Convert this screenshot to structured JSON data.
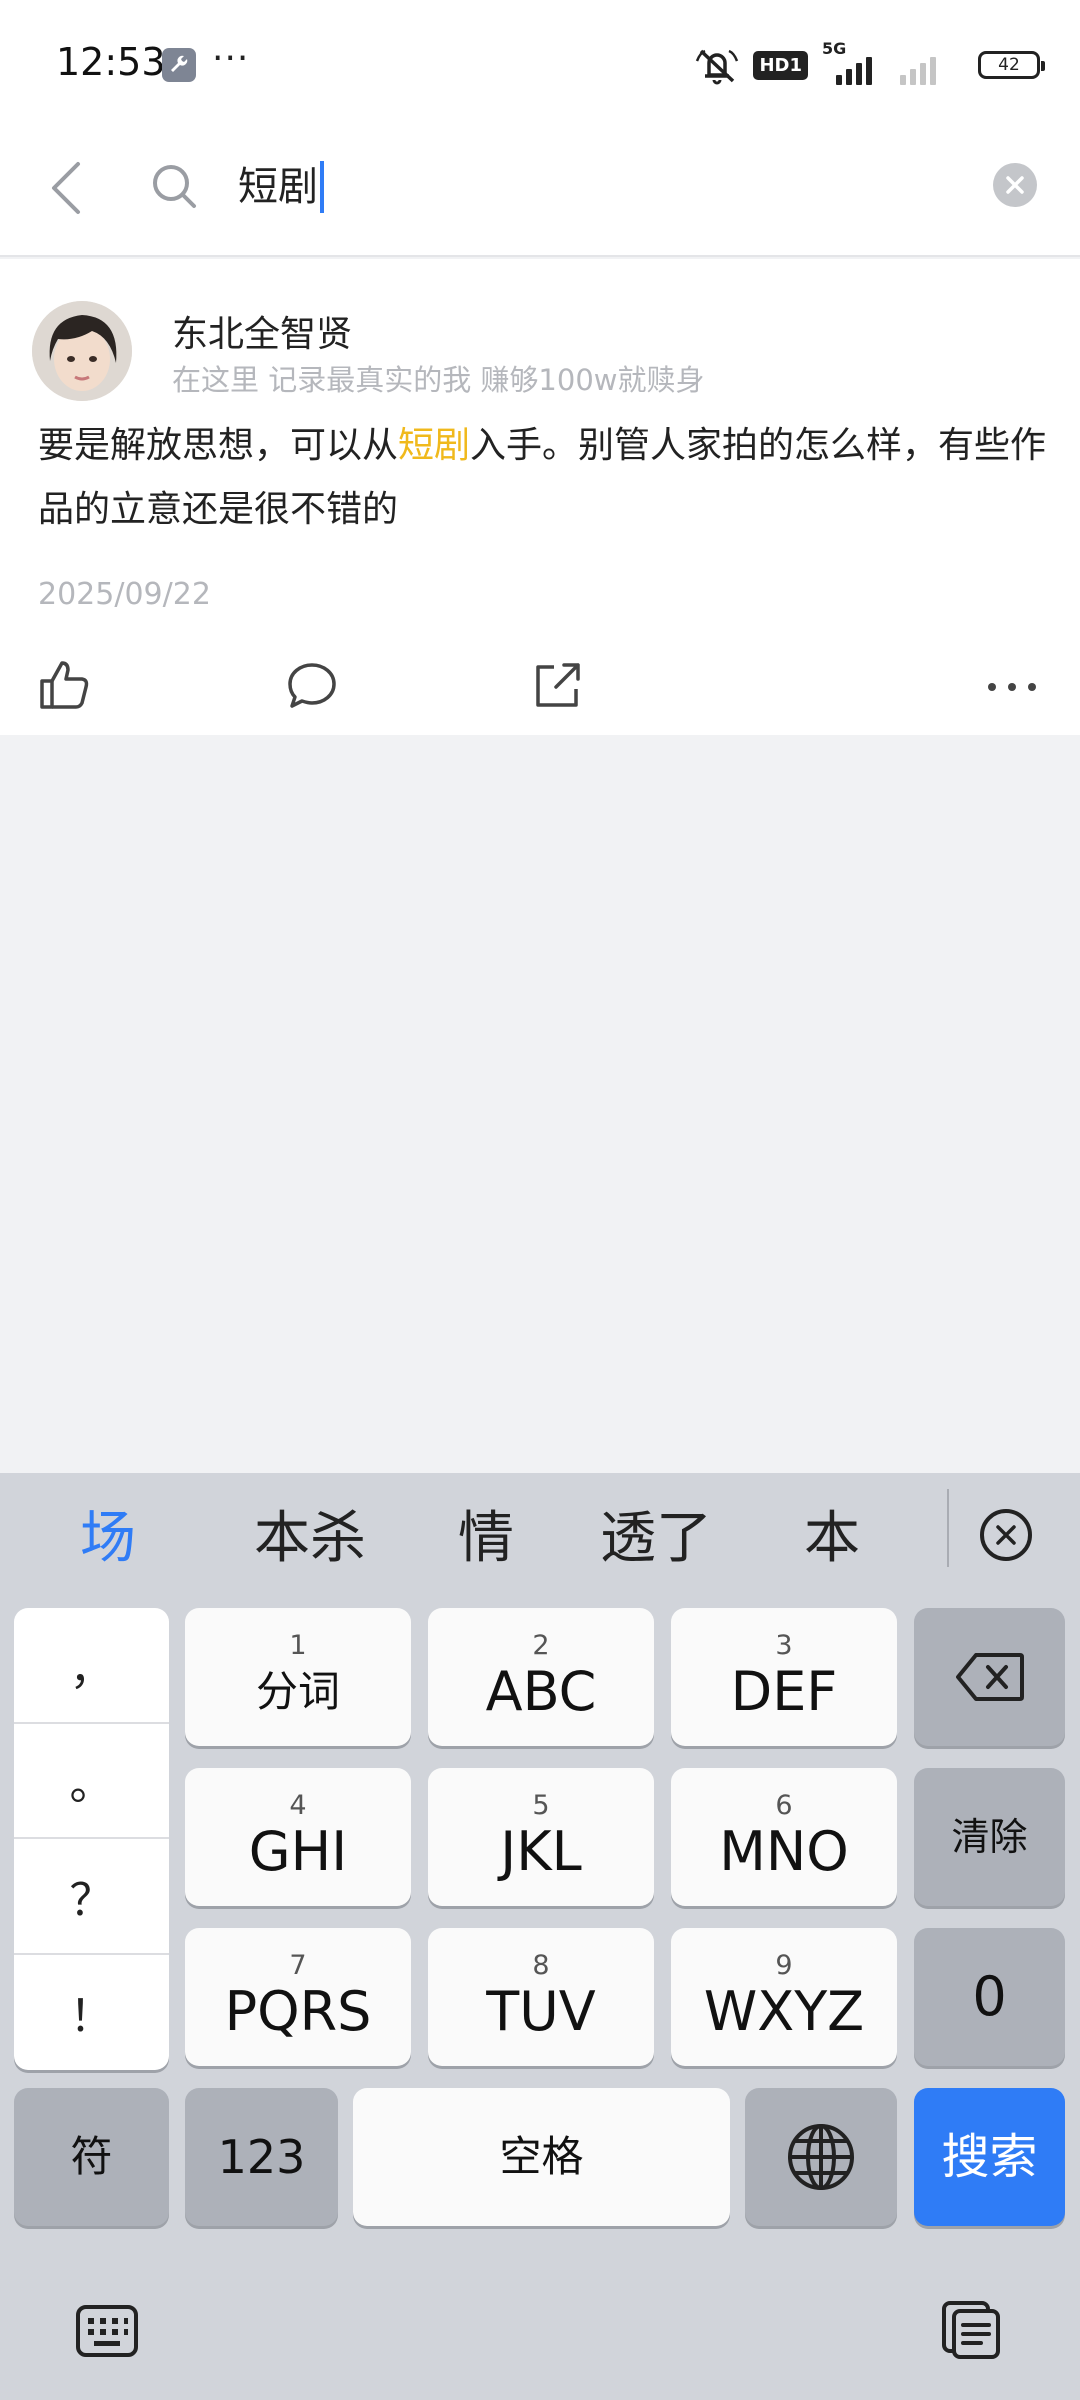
{
  "status_bar": {
    "time": "12:53",
    "dots": "···",
    "hd": "HD1",
    "network": "5G",
    "battery": "42"
  },
  "search": {
    "query": "短剧"
  },
  "post": {
    "author_name": "东北全智贤",
    "author_bio": "在这里  记录最真实的我  赚够100w就赎身",
    "text_before": "要是解放思想，可以从",
    "text_highlight": "短剧",
    "text_after": "入手。别管人家拍的怎么样，有些作品的立意还是很不错的",
    "date": "2025/09/22"
  },
  "keyboard": {
    "candidates": [
      "场",
      "本杀",
      "情",
      "透了",
      "本"
    ],
    "punctuation": [
      "，",
      "。",
      "？",
      "！"
    ],
    "keys": {
      "k1_num": "1",
      "k1_label": "分词",
      "k2_num": "2",
      "k2_label": "ABC",
      "k3_num": "3",
      "k3_label": "DEF",
      "k4_num": "4",
      "k4_label": "GHI",
      "k5_num": "5",
      "k5_label": "JKL",
      "k6_num": "6",
      "k6_label": "MNO",
      "k7_num": "7",
      "k7_label": "PQRS",
      "k8_num": "8",
      "k8_label": "TUV",
      "k9_num": "9",
      "k9_label": "WXYZ",
      "clear": "清除",
      "zero": "0",
      "symbols": "符",
      "numbers": "123",
      "space": "空格",
      "search": "搜索"
    }
  },
  "colors": {
    "accent": "#2f7cf6",
    "highlight": "#f0b91c",
    "muted_text": "#b5b7bc",
    "keyboard_bg": "#d1d4da"
  },
  "icons": [
    "wrench-icon",
    "mute-icon",
    "signal-icon",
    "battery-icon",
    "back-icon",
    "search-icon",
    "clear-icon",
    "like-icon",
    "comment-icon",
    "share-icon",
    "more-icon",
    "collapse-icon",
    "backspace-icon",
    "globe-icon",
    "keyboard-switch-icon",
    "clipboard-icon"
  ]
}
